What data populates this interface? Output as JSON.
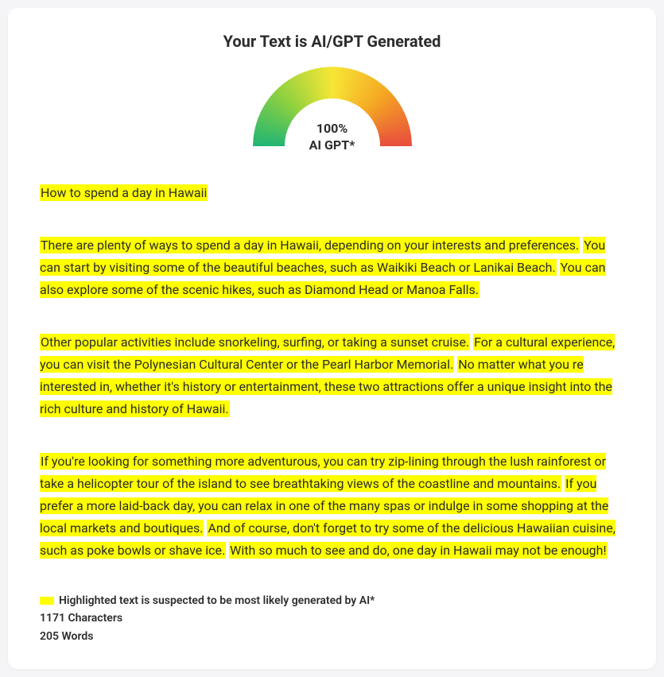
{
  "title": "Your Text is AI/GPT Generated",
  "gauge": {
    "percent_line": "100%",
    "label_line": "AI GPT*"
  },
  "paragraphs": [
    {
      "segments": [
        {
          "text": "How to spend a day in Hawaii",
          "hl": true
        }
      ]
    },
    {
      "segments": [
        {
          "text": "There are plenty of ways to spend a day in Hawaii, depending on your interests and preferences.",
          "hl": true
        },
        {
          "text": " ",
          "hl": false
        },
        {
          "text": "You can start by visiting some of the beautiful beaches, such as Waikiki Beach or Lanikai Beach.",
          "hl": true
        },
        {
          "text": " ",
          "hl": false
        },
        {
          "text": "You can also explore some of the scenic hikes, such as Diamond Head or Manoa Falls.",
          "hl": true
        }
      ]
    },
    {
      "segments": [
        {
          "text": "Other popular activities include snorkeling, surfing, or taking a sunset cruise.",
          "hl": true
        },
        {
          "text": " ",
          "hl": false
        },
        {
          "text": "For a cultural experience, you can visit the Polynesian Cultural Center or the Pearl Harbor Memorial.",
          "hl": true
        },
        {
          "text": " ",
          "hl": false
        },
        {
          "text": "No matter what you re interested in, whether it's history or entertainment, these two attractions offer a unique insight into the rich culture and history of Hawaii.",
          "hl": true
        }
      ]
    },
    {
      "segments": [
        {
          "text": "If you're looking for something more adventurous, you can try zip-lining through the lush rainforest or take a helicopter tour of the island to see breathtaking views of the coastline and mountains.",
          "hl": true
        },
        {
          "text": " ",
          "hl": false
        },
        {
          "text": "If you prefer a more laid-back day, you can relax in one of the many spas or indulge in some shopping at the local markets and boutiques.",
          "hl": true
        },
        {
          "text": " ",
          "hl": false
        },
        {
          "text": "And of course, don't forget to try some of the delicious Hawaiian cuisine, such as poke bowls or shave ice.",
          "hl": true
        },
        {
          "text": " ",
          "hl": false
        },
        {
          "text": "With so much to see and do, one day in Hawaii may not be enough!",
          "hl": true
        }
      ]
    }
  ],
  "legend": {
    "highlight_note": "Highlighted text is suspected to be most likely generated by AI*",
    "characters": "1171 Characters",
    "words": "205 Words"
  }
}
